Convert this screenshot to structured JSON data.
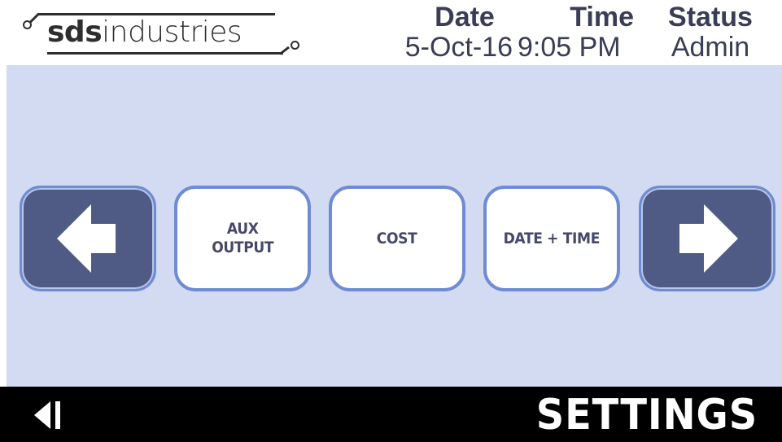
{
  "header": {
    "logo": {
      "bold": "sds",
      "light": "industries"
    },
    "date_heading": "Date",
    "date_value": "5-Oct-16",
    "time_heading": "Time",
    "time_value": "9:05 PM",
    "status_heading": "Status",
    "status_value": "Admin"
  },
  "main": {
    "prev_icon": "arrow-left-icon",
    "next_icon": "arrow-right-icon",
    "options": [
      {
        "label": "AUX\nOUTPUT"
      },
      {
        "label": "COST"
      },
      {
        "label": "DATE + TIME"
      }
    ]
  },
  "footer": {
    "back_icon": "back-triangle-icon",
    "title": "SETTINGS"
  },
  "colors": {
    "panel_bg": "#d3dbf3",
    "nav_button": "#4f5a85",
    "button_border": "#6f8bd3",
    "footer_bg": "#000000"
  }
}
